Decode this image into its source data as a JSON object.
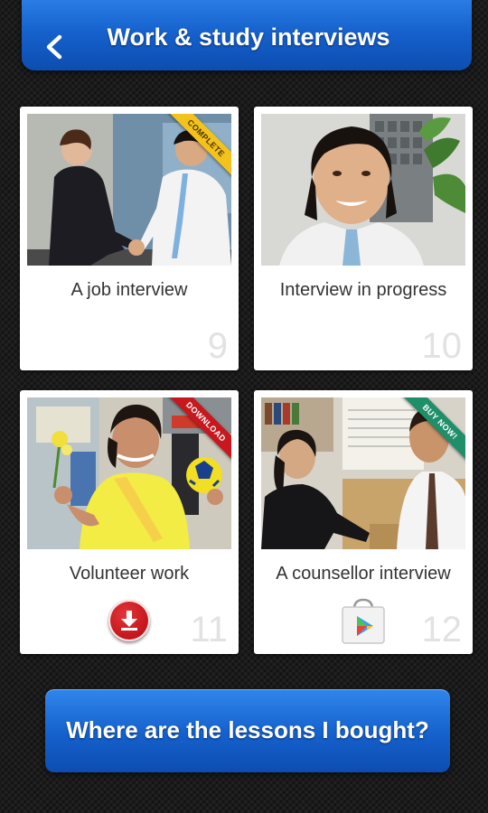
{
  "header": {
    "title": "Work & study interviews",
    "back_icon": "chevron-left-icon"
  },
  "colors": {
    "bar_blue": "#1560cc",
    "ribbon_complete": "#f3c21b",
    "ribbon_download": "#c8181d",
    "ribbon_buy": "#1f8f6a",
    "number_grey": "#e2e2e2"
  },
  "cards": [
    {
      "title": "A job interview",
      "number": "9",
      "ribbon": "COMPLETE",
      "photo": "job-interview-photo"
    },
    {
      "title": "Interview in progress",
      "number": "10",
      "ribbon": "",
      "photo": "interview-in-progress-photo"
    },
    {
      "title": "Volunteer work",
      "number": "11",
      "ribbon": "DOWNLOAD",
      "photo": "volunteer-work-photo",
      "action_icon": "download-icon"
    },
    {
      "title": "A counsellor interview",
      "number": "12",
      "ribbon": "BUY NOW!",
      "photo": "counsellor-interview-photo",
      "action_icon": "play-store-icon"
    }
  ],
  "footer": {
    "label": "Where are the lessons I bought?"
  }
}
